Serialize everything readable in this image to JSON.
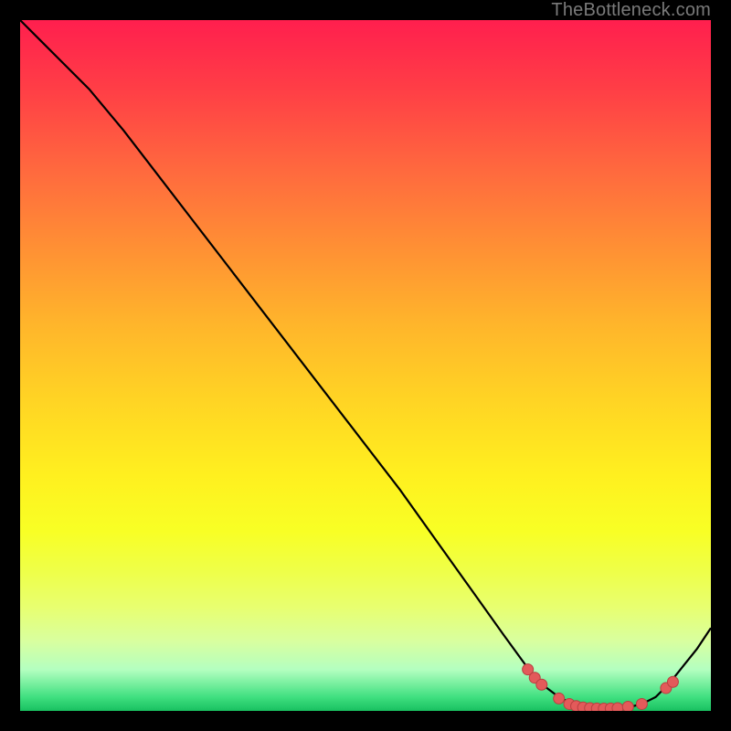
{
  "watermark": "TheBottleneck.com",
  "colors": {
    "page_bg": "#000000",
    "curve_stroke": "#000000",
    "marker_fill": "#e35a5a",
    "marker_stroke": "#b84040"
  },
  "chart_data": {
    "type": "line",
    "title": "",
    "xlabel": "",
    "ylabel": "",
    "xlim": [
      0,
      100
    ],
    "ylim": [
      0,
      100
    ],
    "grid": false,
    "legend": false,
    "series": [
      {
        "name": "bottleneck-curve",
        "x": [
          0,
          3,
          6,
          10,
          15,
          20,
          25,
          30,
          35,
          40,
          45,
          50,
          55,
          60,
          65,
          70,
          74,
          76,
          78,
          80,
          82,
          84,
          86,
          88,
          90,
          92,
          94,
          96,
          98,
          100
        ],
        "y": [
          100,
          97,
          94,
          90,
          84,
          77.5,
          71,
          64.5,
          58,
          51.5,
          45,
          38.5,
          32,
          25,
          18,
          11,
          5.5,
          3.5,
          2,
          1,
          0.5,
          0.3,
          0.3,
          0.5,
          1,
          2,
          4,
          6.5,
          9,
          12
        ]
      }
    ],
    "markers": [
      {
        "x": 73.5,
        "y": 6.0
      },
      {
        "x": 74.5,
        "y": 4.8
      },
      {
        "x": 75.5,
        "y": 3.8
      },
      {
        "x": 78.0,
        "y": 1.8
      },
      {
        "x": 79.5,
        "y": 1.0
      },
      {
        "x": 80.5,
        "y": 0.7
      },
      {
        "x": 81.5,
        "y": 0.5
      },
      {
        "x": 82.5,
        "y": 0.4
      },
      {
        "x": 83.5,
        "y": 0.35
      },
      {
        "x": 84.5,
        "y": 0.33
      },
      {
        "x": 85.5,
        "y": 0.35
      },
      {
        "x": 86.5,
        "y": 0.4
      },
      {
        "x": 88.0,
        "y": 0.6
      },
      {
        "x": 90.0,
        "y": 1.0
      },
      {
        "x": 93.5,
        "y": 3.3
      },
      {
        "x": 94.5,
        "y": 4.2
      }
    ]
  }
}
